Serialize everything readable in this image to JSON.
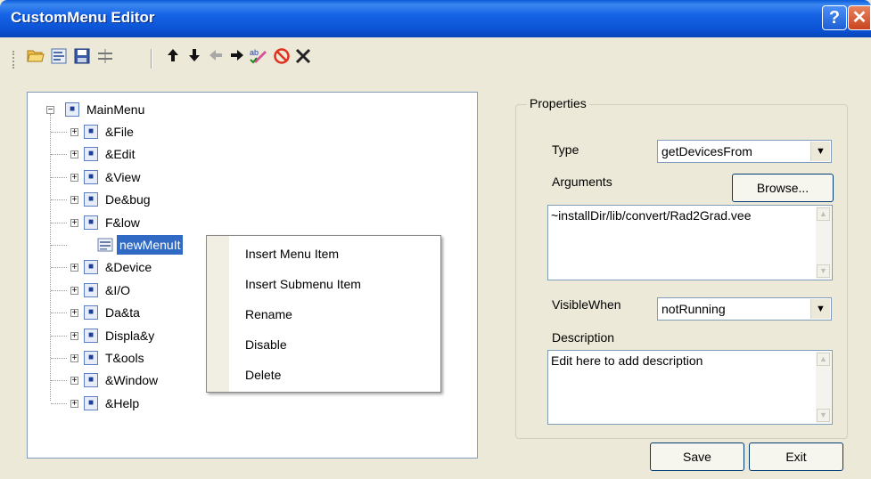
{
  "window": {
    "title": "CustomMenu Editor",
    "help_glyph": "?",
    "close_glyph": "✕"
  },
  "toolbar": {
    "icons": [
      "open-folder-icon",
      "properties-icon",
      "save-icon",
      "separator-icon",
      "arrow-up-icon",
      "arrow-down-icon",
      "arrow-left-icon",
      "arrow-right-icon",
      "spelling-icon",
      "disable-icon",
      "delete-icon"
    ]
  },
  "tree": {
    "root": "MainMenu",
    "items": [
      "&File",
      "&Edit",
      "&View",
      "De&bug",
      "F&low",
      "newMenuIt",
      "&Device",
      "&I/O",
      "Da&ta",
      "Displa&y",
      "T&ools",
      "&Window",
      "&Help"
    ],
    "selected": "newMenuIt"
  },
  "context_menu": {
    "items": [
      "Insert Menu Item",
      "Insert Submenu Item",
      "Rename",
      "Disable",
      "Delete"
    ]
  },
  "properties": {
    "title": "Properties",
    "type_label": "Type",
    "type_value": "getDevicesFrom",
    "arguments_label": "Arguments",
    "browse_label": "Browse...",
    "arguments_value": "~installDir/lib/convert/Rad2Grad.vee",
    "visible_when_label": "VisibleWhen",
    "visible_when_value": "notRunning",
    "description_label": "Description",
    "description_value": "Edit here to add description"
  },
  "footer": {
    "save_label": "Save",
    "exit_label": "Exit"
  }
}
